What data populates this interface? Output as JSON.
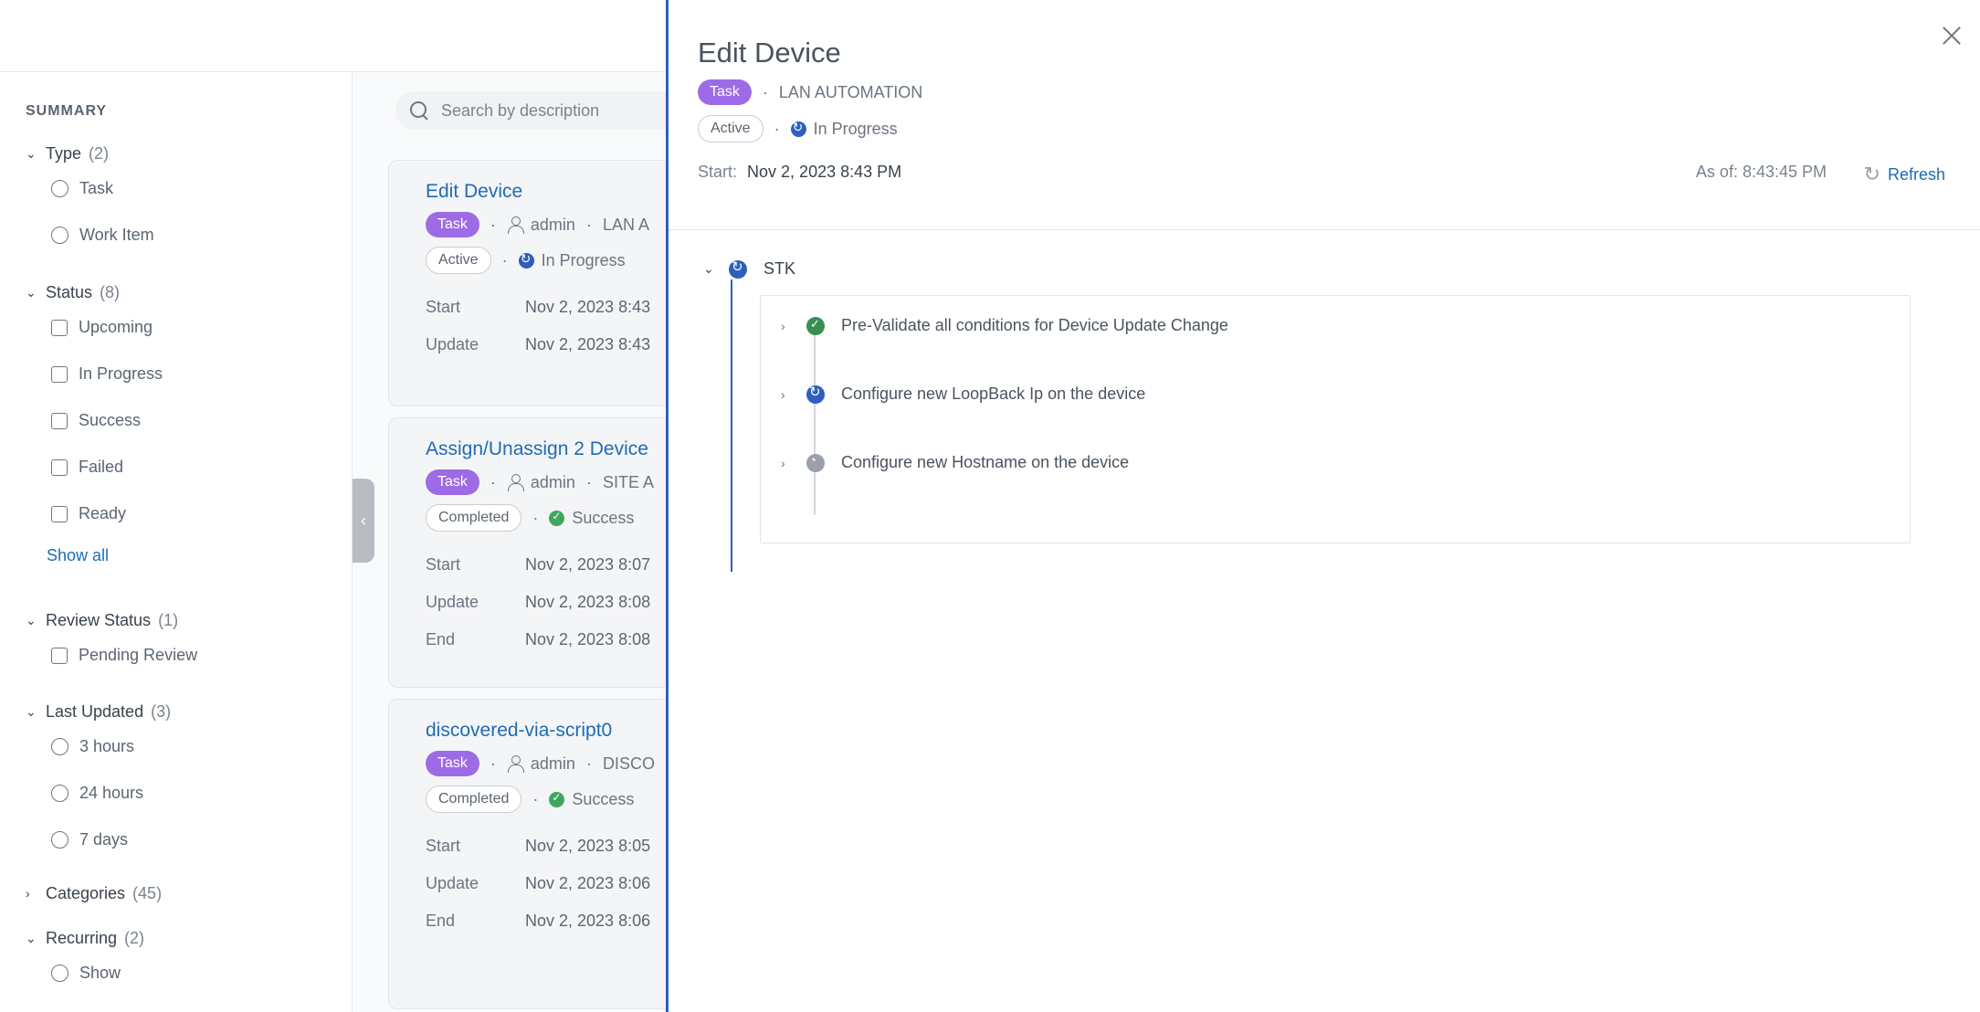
{
  "sidebar": {
    "title": "SUMMARY",
    "groups": {
      "type": {
        "label": "Type",
        "count": "(2)",
        "options": [
          "Task",
          "Work Item"
        ]
      },
      "status": {
        "label": "Status",
        "count": "(8)",
        "options": [
          "Upcoming",
          "In Progress",
          "Success",
          "Failed",
          "Ready"
        ],
        "show_all": "Show all"
      },
      "review": {
        "label": "Review Status",
        "count": "(1)",
        "options": [
          "Pending Review"
        ]
      },
      "last_updated": {
        "label": "Last Updated",
        "count": "(3)",
        "options": [
          "3 hours",
          "24 hours",
          "7 days"
        ]
      },
      "categories": {
        "label": "Categories",
        "count": "(45)"
      },
      "recurring": {
        "label": "Recurring",
        "count": "(2)",
        "options": [
          "Show"
        ]
      }
    }
  },
  "search": {
    "placeholder": "Search by description"
  },
  "cards": [
    {
      "title": "Edit Device",
      "tag": "Task",
      "user": "admin",
      "category": "LAN A",
      "state": "Active",
      "status": "In Progress",
      "rows": [
        {
          "k": "Start",
          "v": "Nov 2, 2023 8:43"
        },
        {
          "k": "Update",
          "v": "Nov 2, 2023 8:43"
        }
      ]
    },
    {
      "title": "Assign/Unassign 2 Device",
      "tag": "Task",
      "user": "admin",
      "category": "SITE A",
      "state": "Completed",
      "status": "Success",
      "rows": [
        {
          "k": "Start",
          "v": "Nov 2, 2023 8:07"
        },
        {
          "k": "Update",
          "v": "Nov 2, 2023 8:08"
        },
        {
          "k": "End",
          "v": "Nov 2, 2023 8:08"
        }
      ]
    },
    {
      "title": "discovered-via-script0",
      "tag": "Task",
      "user": "admin",
      "category": "DISCO",
      "state": "Completed",
      "status": "Success",
      "rows": [
        {
          "k": "Start",
          "v": "Nov 2, 2023 8:05"
        },
        {
          "k": "Update",
          "v": "Nov 2, 2023 8:06"
        },
        {
          "k": "End",
          "v": "Nov 2, 2023 8:06"
        }
      ]
    }
  ],
  "drawer": {
    "title": "Edit Device",
    "tag": "Task",
    "category": "LAN AUTOMATION",
    "state": "Active",
    "status": "In Progress",
    "start_label": "Start:",
    "start_value": "Nov 2, 2023 8:43 PM",
    "as_of": "As of: 8:43:45 PM",
    "refresh_label": "Refresh",
    "group": "STK",
    "steps": [
      {
        "label": "Pre-Validate all conditions for Device Update Change",
        "status": "success"
      },
      {
        "label": "Configure new LoopBack Ip on the device",
        "status": "in-progress"
      },
      {
        "label": "Configure new Hostname on the device",
        "status": "pending"
      }
    ]
  },
  "colors": {
    "accent": "#2f5fbd",
    "task_tag": "#9e6be6",
    "success": "#3ea75d",
    "link": "#1f6bb3"
  }
}
